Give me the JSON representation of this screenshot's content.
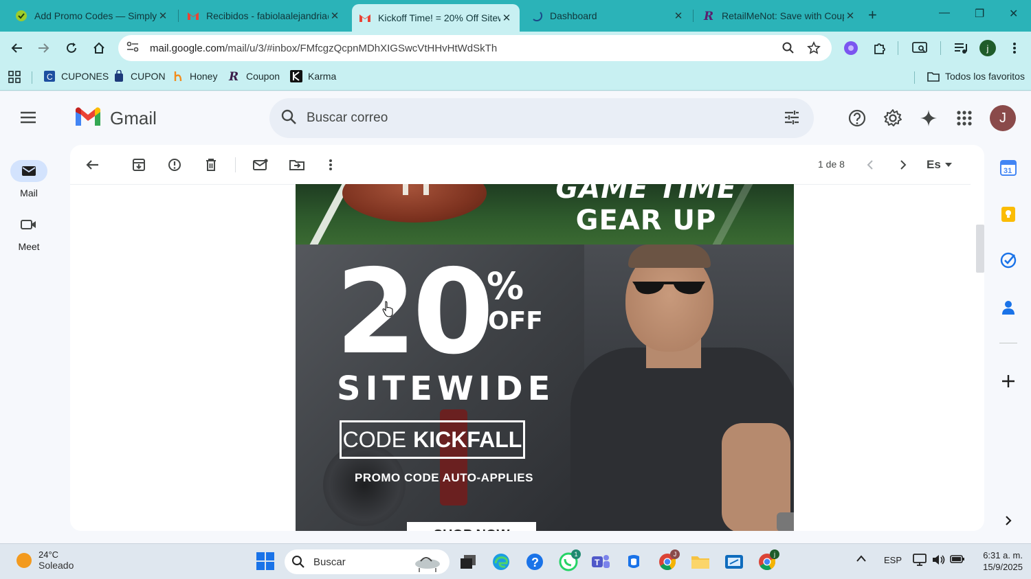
{
  "browser": {
    "tabs": [
      {
        "title": "Add Promo Codes — SimplyC",
        "icon": "simplycodes-icon"
      },
      {
        "title": "Recibidos - fabiolaalejandria@",
        "icon": "gmail-icon"
      },
      {
        "title": "Kickoff Time! = 20% Off Sitew",
        "icon": "gmail-icon",
        "active": true
      },
      {
        "title": "Dashboard",
        "icon": "loading-icon"
      },
      {
        "title": "RetailMeNot: Save with Coup",
        "icon": "retailmenot-icon"
      }
    ],
    "url_host": "mail.google.com",
    "url_path": "/mail/u/3/#inbox/FMfcgzQcpnMDhXIGSwcVtHHvHtWdSkTh",
    "profile_initial": "j",
    "bookmarks": [
      {
        "label": "CUPONES",
        "icon": "cupones-icon"
      },
      {
        "label": "CUPON",
        "icon": "bag-icon"
      },
      {
        "label": "Honey",
        "icon": "honey-icon"
      },
      {
        "label": "Coupon",
        "icon": "retailmenot-icon"
      },
      {
        "label": "Karma",
        "icon": "karma-icon"
      }
    ],
    "all_bookmarks_label": "Todos los favoritos"
  },
  "gmail": {
    "brand": "Gmail",
    "search_placeholder": "Buscar correo",
    "avatar_initial": "J",
    "nav": [
      {
        "label": "Mail",
        "icon": "mail-icon"
      },
      {
        "label": "Meet",
        "icon": "video-icon"
      }
    ],
    "pager_text": "1 de 8",
    "lang_label": "Es"
  },
  "email": {
    "headline_line1": "GAME TIME",
    "headline_line2": "GEAR UP",
    "discount_number": "20",
    "discount_percent": "%",
    "discount_off": "OFF",
    "sitewide": "SITEWIDE",
    "code_label": "CODE",
    "code_value": "KICKFALL",
    "auto_applies": "PROMO CODE AUTO-APPLIES",
    "cta": "SHOP NOW"
  },
  "taskbar": {
    "temperature": "24°C",
    "condition": "Soleado",
    "search_placeholder": "Buscar",
    "language": "ESP",
    "time": "6:31 a. m.",
    "date": "15/9/2025",
    "whatsapp_badge": "1"
  },
  "colors": {
    "tab_strip": "#2bb3b8",
    "toolbar": "#c8f0f2",
    "gmail_bg": "#f6f8fc",
    "avatar": "#8a4a4a"
  }
}
